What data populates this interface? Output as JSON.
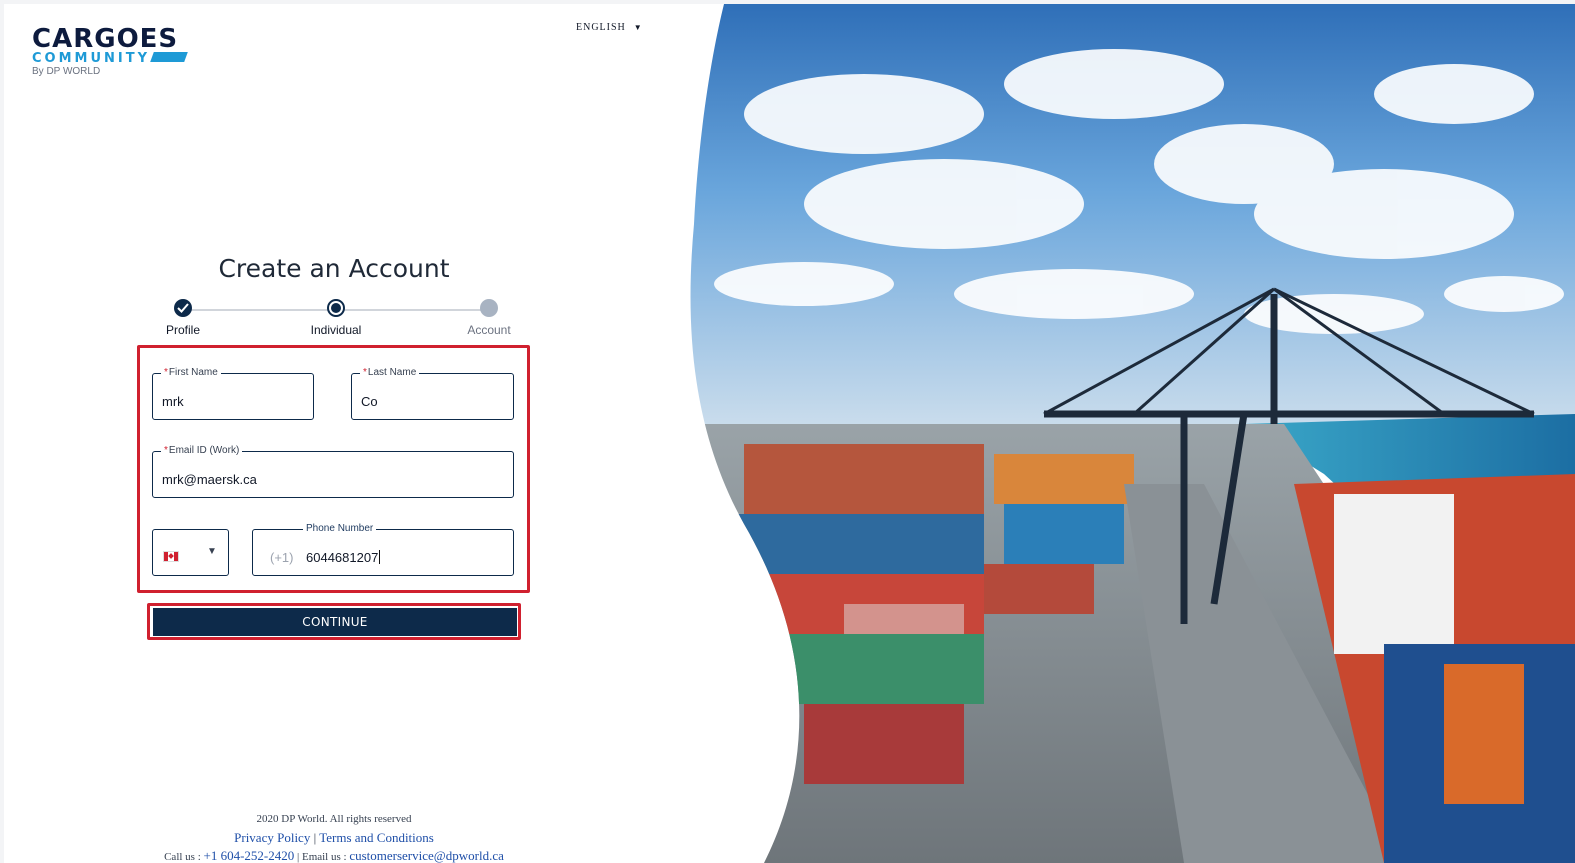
{
  "brand": {
    "logo_line1": "CARGOES",
    "logo_line2": "COMMUNITY",
    "logo_line3": "By DP WORLD",
    "primary_color": "#0d2a4a",
    "accent_color": "#1e9ad6",
    "highlight_color": "#d0202f"
  },
  "language": {
    "label": "ENGLISH"
  },
  "form": {
    "title": "Create an Account",
    "steps": [
      {
        "label": "Profile",
        "state": "completed"
      },
      {
        "label": "Individual",
        "state": "current"
      },
      {
        "label": "Account",
        "state": "pending"
      }
    ],
    "first_name": {
      "label": "First Name",
      "required_mark": "*",
      "value": "mrk"
    },
    "last_name": {
      "label": "Last Name",
      "required_mark": "*",
      "value": "Co"
    },
    "email": {
      "label": "Email ID (Work)",
      "required_mark": "*",
      "value": "mrk@maersk.ca"
    },
    "country": {
      "flag": "canada-flag-icon",
      "selected": "Canada"
    },
    "phone": {
      "label": "Phone Number",
      "prefix": "(+1)",
      "value": "6044681207"
    },
    "continue_label": "CONTINUE"
  },
  "footer": {
    "copyright": "2020 DP World. All rights reserved",
    "privacy": "Privacy Policy",
    "terms": "Terms and Conditions",
    "call_label": "Call us :",
    "phone": "+1 604-252-2420",
    "email_label": "Email us :",
    "email": "customerservice@dpworld.ca"
  }
}
